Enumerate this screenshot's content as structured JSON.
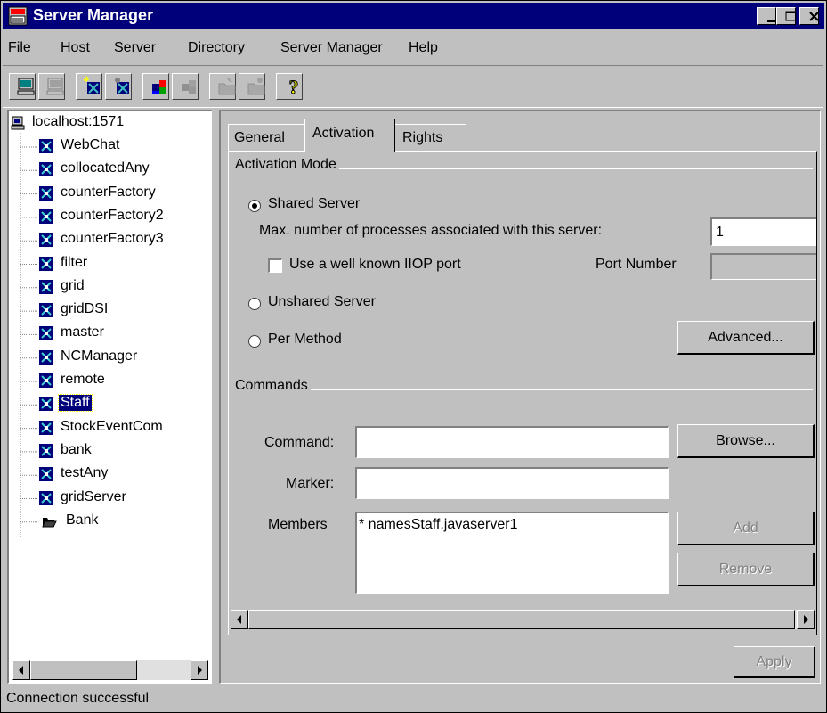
{
  "window": {
    "title": "Server Manager"
  },
  "menu": [
    "File",
    "Host",
    "Server",
    "Directory",
    "Server Manager",
    "Help"
  ],
  "tree": {
    "root": "localhost:1571",
    "items": [
      "WebChat",
      "collocatedAny",
      "counterFactory",
      "counterFactory2",
      "counterFactory3",
      "filter",
      "grid",
      "gridDSI",
      "master",
      "NCManager",
      "remote",
      "Staff",
      "StockEventCom",
      "bank",
      "testAny",
      "gridServer",
      "Bank"
    ],
    "selected": "Staff"
  },
  "tabs": [
    "General",
    "Activation",
    "Rights"
  ],
  "active_tab": "Activation",
  "activation": {
    "group_label": "Activation Mode",
    "shared_label": "Shared Server",
    "max_processes_label": "Max. number of processes associated with this server:",
    "max_processes_value": "1",
    "iiop_label": "Use a well known IIOP port",
    "port_label": "Port Number",
    "port_value": "",
    "unshared_label": "Unshared Server",
    "per_method_label": "Per Method",
    "advanced_label": "Advanced...",
    "selected_mode": "Shared Server"
  },
  "commands": {
    "group_label": "Commands",
    "command_label": "Command:",
    "command_value": "",
    "browse_label": "Browse...",
    "marker_label": "Marker:",
    "marker_value": "",
    "members_label": "Members",
    "members": [
      "* namesStaff.javaserver1"
    ],
    "add_label": "Add",
    "remove_label": "Remove"
  },
  "apply_label": "Apply",
  "status": "Connection successful",
  "colors": {
    "titlebar": "#00007b",
    "face": "#c0c0c0",
    "selection": "#00007b"
  }
}
